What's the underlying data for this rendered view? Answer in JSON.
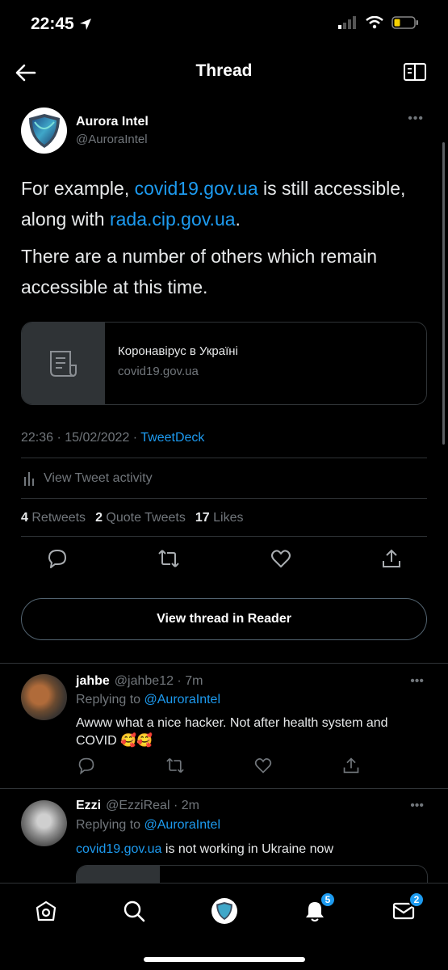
{
  "status_bar": {
    "time": "22:45"
  },
  "header": {
    "title": "Thread"
  },
  "main_tweet": {
    "name": "Aurora Intel",
    "handle": "@AuroraIntel",
    "text1_a": "For example, ",
    "text1_link1": "covid19.gov.ua",
    "text1_b": " is still accessible,  along with ",
    "text1_link2": "rada.cip.gov.ua",
    "text1_c": ".",
    "text2": "There are a number of others which remain accessible at this time.",
    "card": {
      "title": "Коронавірус в Україні",
      "domain": "covid19.gov.ua"
    },
    "timestamp": "22:36 · 15/02/2022 · ",
    "source": "TweetDeck",
    "activity_label": "View Tweet activity",
    "retweets_count": "4",
    "retweets_label": "Retweets",
    "quotes_count": "2",
    "quotes_label": "Quote Tweets",
    "likes_count": "17",
    "likes_label": "Likes",
    "reader_button": "View thread in Reader"
  },
  "replies": [
    {
      "name": "jahbe",
      "handle": "@jahbe12 · 7m",
      "replying_prefix": "Replying to ",
      "replying_to": "@AuroraIntel",
      "text": "Awww what a nice hacker. Not after health system and COVID 🥰🥰"
    },
    {
      "name": "Ezzi",
      "handle": "@EzziReal · 2m",
      "replying_prefix": "Replying to ",
      "replying_to": "@AuroraIntel",
      "text_link": "covid19.gov.ua",
      "text": " is not working in Ukraine now"
    }
  ],
  "bottom_nav": {
    "notifications_badge": "5",
    "messages_badge": "2"
  },
  "colors": {
    "accent": "#1d9bf0",
    "background": "#000000",
    "muted": "#71767b",
    "divider": "#2f3336"
  }
}
